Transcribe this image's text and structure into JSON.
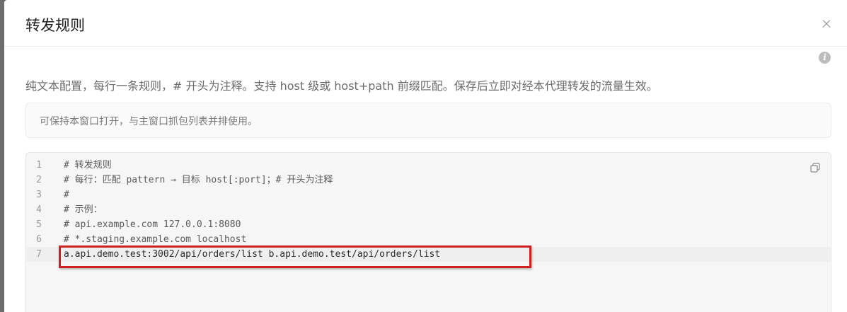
{
  "dialog": {
    "title": "转发规则",
    "description": "纯文本配置，每行一条规则，# 开头为注释。支持 host 级或 host+path 前缀匹配。保存后立即对经本代理转发的流量生效。",
    "notice": "可保持本窗口打开，与主窗口抓包列表并排使用。"
  },
  "editor": {
    "lines": [
      {
        "num": "1",
        "text": "# 转发规则"
      },
      {
        "num": "2",
        "text": "# 每行：匹配 pattern → 目标 host[:port]；# 开头为注释"
      },
      {
        "num": "3",
        "text": "#"
      },
      {
        "num": "4",
        "text": "# 示例："
      },
      {
        "num": "5",
        "text": "# api.example.com   127.0.0.1:8080"
      },
      {
        "num": "6",
        "text": "# *.staging.example.com localhost"
      },
      {
        "num": "7",
        "text": "a.api.demo.test:3002/api/orders/list    b.api.demo.test/api/orders/list"
      }
    ],
    "active_line": 7
  },
  "icons": {
    "close": "close-icon",
    "info": "info-icon",
    "copy": "copy-icon"
  },
  "colors": {
    "highlight": "#cf1f1f"
  }
}
